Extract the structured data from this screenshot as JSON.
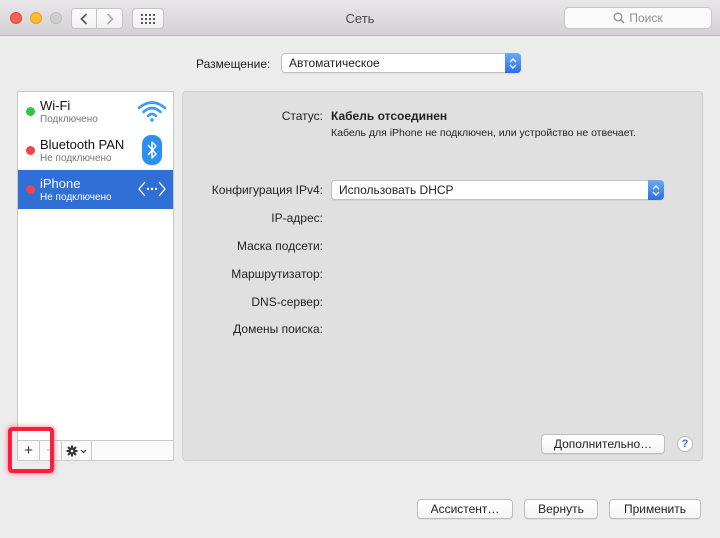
{
  "window": {
    "title": "Сеть"
  },
  "search": {
    "placeholder": "Поиск"
  },
  "location": {
    "label": "Размещение:",
    "value": "Автоматическое"
  },
  "services": [
    {
      "name": "Wi-Fi",
      "status": "Подключено",
      "dot_color": "#2ec743",
      "icon": "wifi-icon",
      "selected": false
    },
    {
      "name": "Bluetooth PAN",
      "status": "Не подключено",
      "dot_color": "#f1434c",
      "icon": "bluetooth-icon",
      "selected": false
    },
    {
      "name": "iPhone",
      "status": "Не подключено",
      "dot_color": "#f1434c",
      "icon": "iphone-connection-icon",
      "selected": true
    }
  ],
  "sidebar_tools": {
    "add": "+",
    "remove": "−"
  },
  "detail": {
    "status_label": "Статус:",
    "status_value": "Кабель отсоединен",
    "status_desc": "Кабель для iPhone не подключен, или устройство не отвечает.",
    "ipv4_label": "Конфигурация IPv4:",
    "ipv4_value": "Использовать DHCP",
    "ip_label": "IP-адрес:",
    "mask_label": "Маска подсети:",
    "router_label": "Маршрутизатор:",
    "dns_label": "DNS-сервер:",
    "domains_label": "Домены поиска:",
    "advanced_button": "Дополнительно…",
    "help": "?"
  },
  "footer": {
    "assistant": "Ассистент…",
    "revert": "Вернуть",
    "apply": "Применить"
  },
  "colors": {
    "accent": "#2f6fd6",
    "highlight": "#ff1c3c"
  }
}
